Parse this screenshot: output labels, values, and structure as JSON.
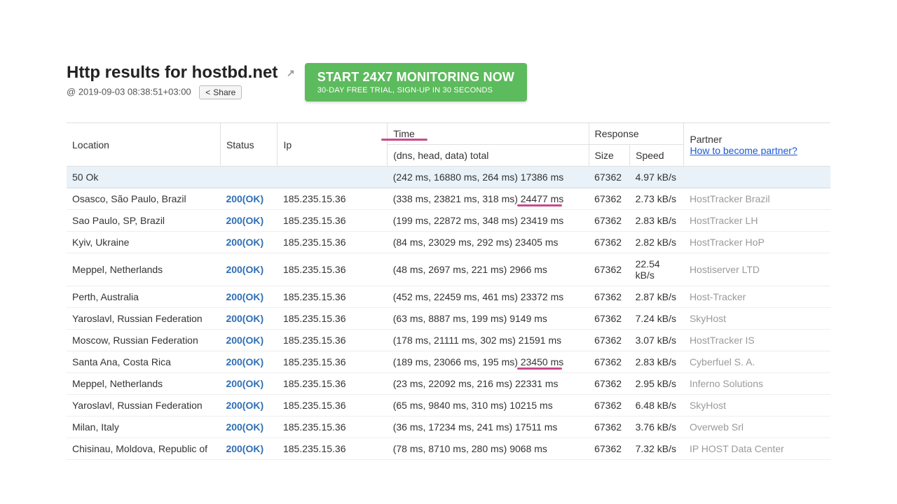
{
  "header": {
    "title": "Http results for hostbd.net",
    "timestamp_prefix": "@ ",
    "timestamp": "2019-09-03 08:38:51+03:00",
    "share_label": "Share"
  },
  "cta": {
    "title": "START 24X7 MONITORING NOW",
    "subtitle": "30-DAY FREE TRIAL, SIGN-UP IN 30 SECONDS"
  },
  "columns": {
    "location": "Location",
    "status": "Status",
    "ip": "Ip",
    "time": "Time",
    "time_sub": "(dns, head, data) total",
    "response": "Response",
    "size": "Size",
    "speed": "Speed",
    "partner": "Partner",
    "partner_link": "How to become partner?"
  },
  "summary": {
    "status": "50 Ok",
    "time": "(242 ms, 16880 ms, 264 ms) 17386 ms",
    "size": "67362",
    "speed": "4.97 kB/s"
  },
  "rows": [
    {
      "location": "Osasco, São Paulo, Brazil",
      "status": "200(OK)",
      "ip": "185.235.15.36",
      "time": "(338 ms, 23821 ms, 318 ms) 24477 ms",
      "size": "67362",
      "speed": "2.73 kB/s",
      "partner": "HostTracker Brazil",
      "highlight": true
    },
    {
      "location": "Sao Paulo, SP, Brazil",
      "status": "200(OK)",
      "ip": "185.235.15.36",
      "time": "(199 ms, 22872 ms, 348 ms) 23419 ms",
      "size": "67362",
      "speed": "2.83 kB/s",
      "partner": "HostTracker LH",
      "highlight": false
    },
    {
      "location": "Kyiv, Ukraine",
      "status": "200(OK)",
      "ip": "185.235.15.36",
      "time": "(84 ms, 23029 ms, 292 ms) 23405 ms",
      "size": "67362",
      "speed": "2.82 kB/s",
      "partner": "HostTracker HoP",
      "highlight": false
    },
    {
      "location": "Meppel, Netherlands",
      "status": "200(OK)",
      "ip": "185.235.15.36",
      "time": "(48 ms, 2697 ms, 221 ms) 2966 ms",
      "size": "67362",
      "speed": "22.54 kB/s",
      "partner": "Hostiserver LTD",
      "highlight": false
    },
    {
      "location": "Perth, Australia",
      "status": "200(OK)",
      "ip": "185.235.15.36",
      "time": "(452 ms, 22459 ms, 461 ms) 23372 ms",
      "size": "67362",
      "speed": "2.87 kB/s",
      "partner": "Host-Tracker",
      "highlight": false
    },
    {
      "location": "Yaroslavl, Russian Federation",
      "status": "200(OK)",
      "ip": "185.235.15.36",
      "time": "(63 ms, 8887 ms, 199 ms) 9149 ms",
      "size": "67362",
      "speed": "7.24 kB/s",
      "partner": "SkyHost",
      "highlight": false
    },
    {
      "location": "Moscow, Russian Federation",
      "status": "200(OK)",
      "ip": "185.235.15.36",
      "time": "(178 ms, 21111 ms, 302 ms) 21591 ms",
      "size": "67362",
      "speed": "3.07 kB/s",
      "partner": "HostTracker IS",
      "highlight": false
    },
    {
      "location": "Santa Ana, Costa Rica",
      "status": "200(OK)",
      "ip": "185.235.15.36",
      "time": "(189 ms, 23066 ms, 195 ms) 23450 ms",
      "size": "67362",
      "speed": "2.83 kB/s",
      "partner": "Cyberfuel S. A.",
      "highlight": true
    },
    {
      "location": "Meppel, Netherlands",
      "status": "200(OK)",
      "ip": "185.235.15.36",
      "time": "(23 ms, 22092 ms, 216 ms) 22331 ms",
      "size": "67362",
      "speed": "2.95 kB/s",
      "partner": "Inferno Solutions",
      "highlight": false
    },
    {
      "location": "Yaroslavl, Russian Federation",
      "status": "200(OK)",
      "ip": "185.235.15.36",
      "time": "(65 ms, 9840 ms, 310 ms) 10215 ms",
      "size": "67362",
      "speed": "6.48 kB/s",
      "partner": "SkyHost",
      "highlight": false
    },
    {
      "location": "Milan, Italy",
      "status": "200(OK)",
      "ip": "185.235.15.36",
      "time": "(36 ms, 17234 ms, 241 ms) 17511 ms",
      "size": "67362",
      "speed": "3.76 kB/s",
      "partner": "Overweb Srl",
      "highlight": false
    },
    {
      "location": "Chisinau, Moldova, Republic of",
      "status": "200(OK)",
      "ip": "185.235.15.36",
      "time": "(78 ms, 8710 ms, 280 ms) 9068 ms",
      "size": "67362",
      "speed": "7.32 kB/s",
      "partner": "IP HOST Data Center",
      "highlight": false
    }
  ]
}
